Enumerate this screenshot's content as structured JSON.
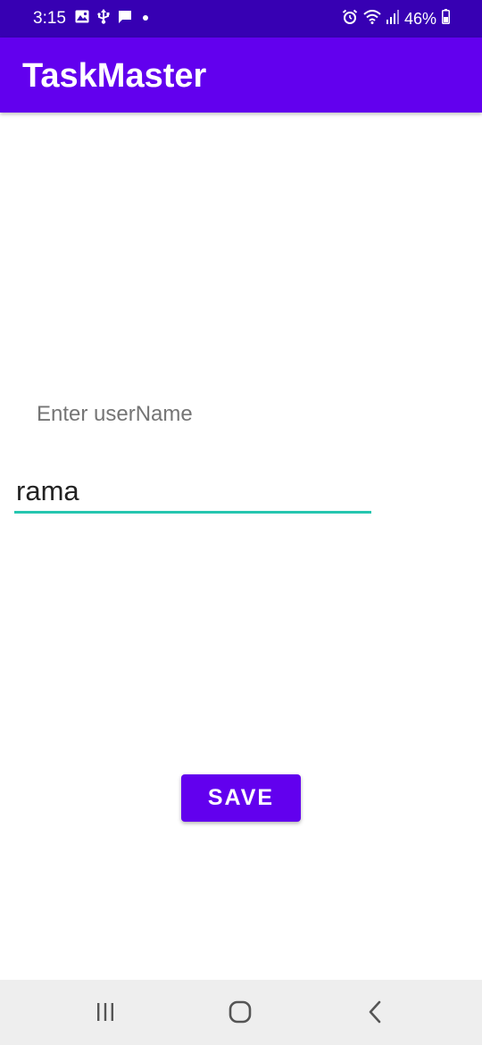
{
  "status_bar": {
    "time": "3:15",
    "battery": "46%",
    "left_icons": [
      "gallery-icon",
      "usb-icon",
      "message-icon",
      "dot-icon"
    ],
    "right_icons": [
      "alarm-icon",
      "wifi-icon",
      "signal-icon"
    ]
  },
  "app_bar": {
    "title": "TaskMaster",
    "color": "#6200ee",
    "status_color": "#3700b3"
  },
  "form": {
    "label": "Enter userName",
    "username_value": "rama",
    "underline_color": "#26c6b0"
  },
  "save_button": {
    "label": "SAVE"
  },
  "nav_bar": {
    "buttons": [
      "recents-icon",
      "home-icon",
      "back-icon"
    ]
  }
}
